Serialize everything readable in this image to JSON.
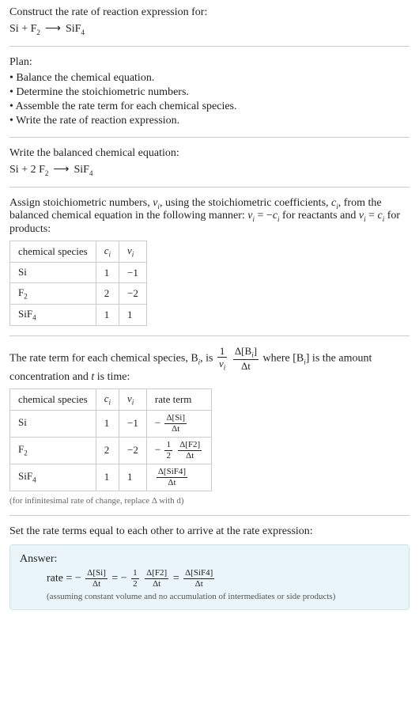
{
  "prompt": {
    "line1": "Construct the rate of reaction expression for:",
    "equation_parts": {
      "si": "Si",
      "plus": " + ",
      "f2": "F",
      "f2_sub": "2",
      "arrow": "⟶",
      "sif4": "SiF",
      "sif4_sub": "4"
    }
  },
  "plan": {
    "heading": "Plan:",
    "items": [
      "• Balance the chemical equation.",
      "• Determine the stoichiometric numbers.",
      "• Assemble the rate term for each chemical species.",
      "• Write the rate of reaction expression."
    ]
  },
  "balanced": {
    "heading": "Write the balanced chemical equation:",
    "parts": {
      "si": "Si",
      "plus": " + 2 ",
      "f2": "F",
      "f2_sub": "2",
      "arrow": "⟶",
      "sif4": "SiF",
      "sif4_sub": "4"
    }
  },
  "assign": {
    "text_before_nu": "Assign stoichiometric numbers, ",
    "nu_i": "ν",
    "i_sub": "i",
    "text_mid1": ", using the stoichiometric coefficients, ",
    "c_i": "c",
    "text_mid2": ", from the balanced chemical equation in the following manner: ",
    "eq1": " = −",
    "text_mid3": " for reactants and ",
    "eq2": " = ",
    "text_end": " for products:"
  },
  "table1": {
    "headers": {
      "species": "chemical species",
      "ci": "c",
      "ci_sub": "i",
      "nui": "ν",
      "nui_sub": "i"
    },
    "rows": [
      {
        "species": "Si",
        "species_sub": "",
        "ci": "1",
        "nui": "−1"
      },
      {
        "species": "F",
        "species_sub": "2",
        "ci": "2",
        "nui": "−2"
      },
      {
        "species": "SiF",
        "species_sub": "4",
        "ci": "1",
        "nui": "1"
      }
    ]
  },
  "rate_term": {
    "text1": "The rate term for each chemical species, B",
    "i_sub": "i",
    "text2": ", is ",
    "frac1_num": "1",
    "frac1_den_nu": "ν",
    "frac2_num_a": "Δ[B",
    "frac2_num_b": "]",
    "frac2_den": "Δt",
    "text3": " where [B",
    "text4": "] is the amount concentration and ",
    "t_var": "t",
    "text5": " is time:"
  },
  "table2": {
    "headers": {
      "species": "chemical species",
      "ci": "c",
      "ci_sub": "i",
      "nui": "ν",
      "nui_sub": "i",
      "rate": "rate term"
    },
    "rows": [
      {
        "species": "Si",
        "species_sub": "",
        "ci": "1",
        "nui": "−1",
        "rate_prefix": "−",
        "rate_num": "Δ[Si]",
        "rate_den": "Δt",
        "rate_coef_num": "",
        "rate_coef_den": ""
      },
      {
        "species": "F",
        "species_sub": "2",
        "ci": "2",
        "nui": "−2",
        "rate_prefix": "−",
        "rate_num": "Δ[F2]",
        "rate_den": "Δt",
        "rate_coef_num": "1",
        "rate_coef_den": "2"
      },
      {
        "species": "SiF",
        "species_sub": "4",
        "ci": "1",
        "nui": "1",
        "rate_prefix": "",
        "rate_num": "Δ[SiF4]",
        "rate_den": "Δt",
        "rate_coef_num": "",
        "rate_coef_den": ""
      }
    ],
    "note": "(for infinitesimal rate of change, replace Δ with d)"
  },
  "final": {
    "heading": "Set the rate terms equal to each other to arrive at the rate expression:"
  },
  "answer": {
    "label": "Answer:",
    "rate_label": "rate = ",
    "neg": "−",
    "si_num": "Δ[Si]",
    "si_den": "Δt",
    "eq": " = ",
    "half_num": "1",
    "half_den": "2",
    "f2_num": "Δ[F2]",
    "f2_den": "Δt",
    "sif4_num": "Δ[SiF4]",
    "sif4_den": "Δt",
    "note": "(assuming constant volume and no accumulation of intermediates or side products)"
  }
}
